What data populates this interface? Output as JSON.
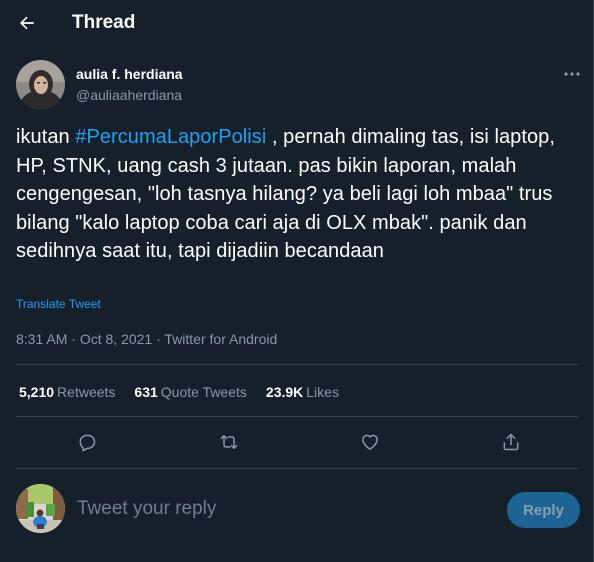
{
  "header": {
    "title": "Thread"
  },
  "author": {
    "name": "aulia f. herdiana",
    "handle": "@auliaaherdiana"
  },
  "tweet": {
    "text_before_hashtag": "ikutan ",
    "hashtag": "#PercumaLaporPolisi",
    "text_after_hashtag": " , pernah dimaling tas, isi laptop, HP, STNK, uang cash 3 jutaan. pas bikin laporan, malah cengengesan, \"loh tasnya hilang? ya beli lagi loh mbaa\" trus bilang \"kalo laptop coba cari aja di OLX mbak\". panik dan sedihnya saat itu, tapi dijadiin becandaan",
    "translate_label": "Translate Tweet",
    "time": "8:31 AM",
    "separator": "·",
    "date": "Oct 8, 2021",
    "source": "Twitter for Android"
  },
  "stats": {
    "retweets_count": "5,210",
    "retweets_label": "Retweets",
    "quotes_count": "631",
    "quotes_label": "Quote Tweets",
    "likes_count": "23.9K",
    "likes_label": "Likes"
  },
  "actions": {
    "reply_icon": "reply-icon",
    "retweet_icon": "retweet-icon",
    "like_icon": "heart-icon",
    "share_icon": "share-icon"
  },
  "reply": {
    "placeholder": "Tweet your reply",
    "button_label": "Reply"
  },
  "colors": {
    "background": "#15202b",
    "accent": "#1da1f2",
    "muted": "#8899a6",
    "divider": "#38444d",
    "reply_button_bg": "#1d6394"
  }
}
